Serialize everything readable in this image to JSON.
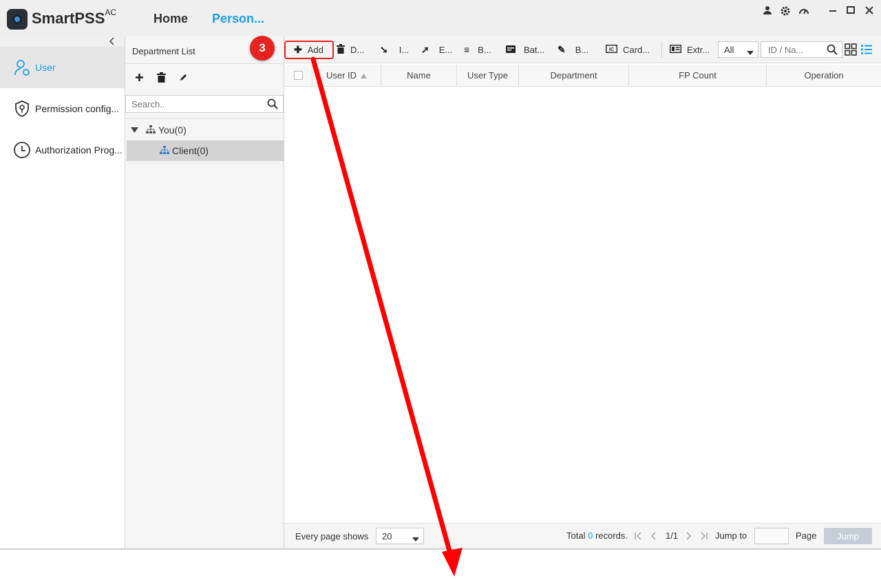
{
  "app": {
    "brand": "SmartPSS",
    "brand_suffix": "AC",
    "tabs": [
      {
        "label": "Home"
      },
      {
        "label": "Person..."
      }
    ]
  },
  "sidebar": {
    "items": [
      {
        "label": "User"
      },
      {
        "label": "Permission config..."
      },
      {
        "label": "Authorization Prog..."
      }
    ]
  },
  "department": {
    "title": "Department List",
    "search_placeholder": "Search..",
    "tree": [
      {
        "label": "You(0)"
      },
      {
        "label": "Client(0)"
      }
    ]
  },
  "annotation": {
    "step": "3"
  },
  "toolbar": {
    "add": "Add",
    "delete": "D...",
    "import": "I...",
    "export": "E...",
    "batch_add": "B...",
    "batch_card": "Bat...",
    "batch_edit": "B...",
    "card": "Card...",
    "extract": "Extr...",
    "filter_value": "All",
    "search_placeholder": "ID / Na..."
  },
  "table": {
    "columns": [
      "User ID",
      "Name",
      "User Type",
      "Department",
      "FP Count",
      "Operation"
    ]
  },
  "footer": {
    "every_page_label": "Every page shows",
    "page_size": "20",
    "total_prefix": "Total",
    "total_count": "0",
    "total_suffix": "records.",
    "page_indicator": "1/1",
    "jump_to": "Jump to",
    "page_label": "Page",
    "jump_button": "Jump"
  },
  "colors": {
    "accent": "#1aa0e6",
    "annotation_red": "#e8221f"
  }
}
